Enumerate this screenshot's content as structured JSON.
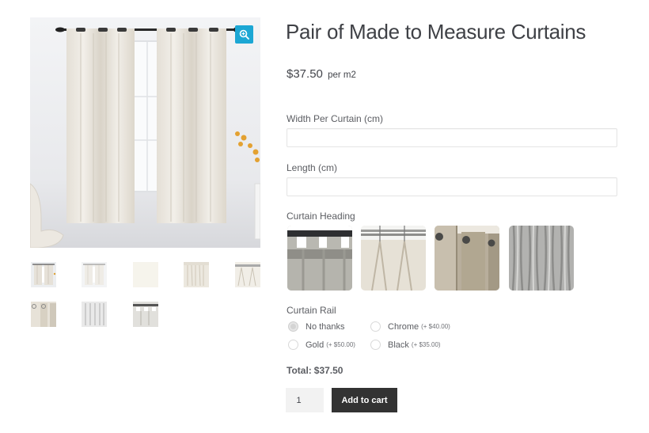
{
  "gallery": {
    "zoom_icon": "magnifier-plus-icon",
    "main_image_alt": "Cream eyelet curtains hanging on black rod in front of window",
    "thumbnails": [
      {
        "alt": "Curtains on rod in room"
      },
      {
        "alt": "Curtains on rod faded"
      },
      {
        "alt": "Fabric swatch cream"
      },
      {
        "alt": "Pleated curtain detail"
      },
      {
        "alt": "Pinch pleat heading on rail"
      },
      {
        "alt": "Eyelet heading closeup"
      },
      {
        "alt": "Wave heading folds"
      },
      {
        "alt": "Tab top heading"
      }
    ]
  },
  "product": {
    "title": "Pair of Made to Measure Curtains",
    "price": "$37.50",
    "price_unit": "per m2"
  },
  "fields": {
    "width": {
      "label": "Width Per Curtain (cm)",
      "value": "",
      "placeholder": ""
    },
    "length": {
      "label": "Length (cm)",
      "value": "",
      "placeholder": ""
    }
  },
  "heading": {
    "label": "Curtain Heading",
    "options": [
      {
        "name": "Tab Top"
      },
      {
        "name": "Pinch Pleat"
      },
      {
        "name": "Eyelet"
      },
      {
        "name": "Wave"
      }
    ]
  },
  "rail": {
    "label": "Curtain Rail",
    "selected": "No thanks",
    "options": [
      {
        "label": "No thanks",
        "price": "",
        "checked": true
      },
      {
        "label": "Chrome",
        "price": "(+ $40.00)",
        "checked": false
      },
      {
        "label": "Gold",
        "price": "(+ $50.00)",
        "checked": false
      },
      {
        "label": "Black",
        "price": "(+ $35.00)",
        "checked": false
      }
    ]
  },
  "total": {
    "label": "Total:",
    "value": "$37.50"
  },
  "cart": {
    "quantity": "1",
    "add_label": "Add to cart"
  },
  "colors": {
    "zoom_button": "#1ca7d4",
    "add_to_cart": "#333333"
  }
}
